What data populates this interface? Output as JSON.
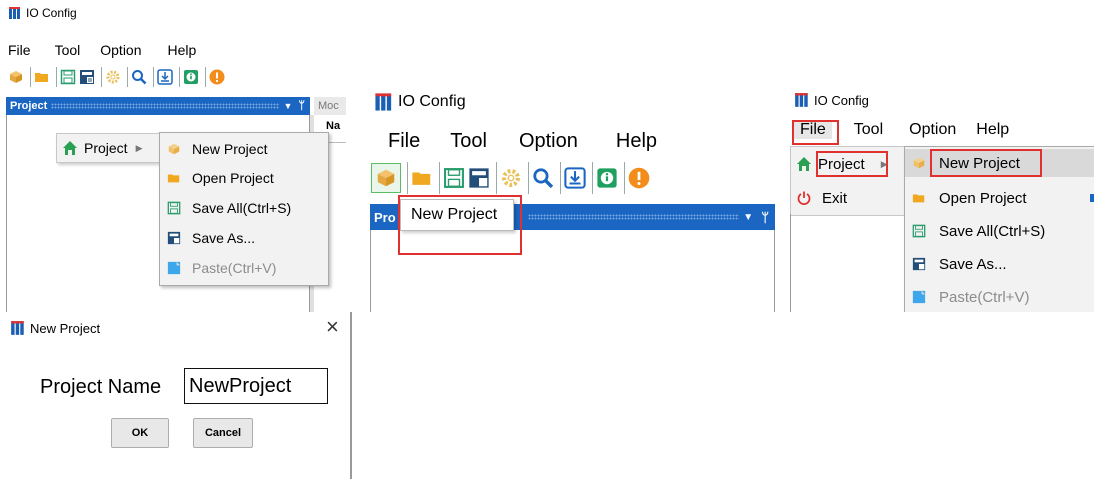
{
  "app": {
    "title": "IO Config"
  },
  "menubar": {
    "file": "File",
    "tool": "Tool",
    "option": "Option",
    "help": "Help"
  },
  "dock": {
    "project_title": "Project",
    "project_abbrev": "Pro",
    "module_abbrev": "Moc",
    "name_abbrev": "Na"
  },
  "project_menu": {
    "project": "Project",
    "items": [
      "New Project",
      "Open Project",
      "Save All(Ctrl+S)",
      "Save As...",
      "Paste(Ctrl+V)"
    ],
    "exit": "Exit"
  },
  "tooltip": {
    "new_project": "New Project"
  },
  "dialog": {
    "title": "New Project",
    "label": "Project Name",
    "value": "NewProject",
    "ok": "OK",
    "cancel": "Cancel",
    "close": "×"
  },
  "colors": {
    "accent": "#1a66c2",
    "highlight": "#e0302f",
    "menu_bg": "#f2f2f2"
  }
}
